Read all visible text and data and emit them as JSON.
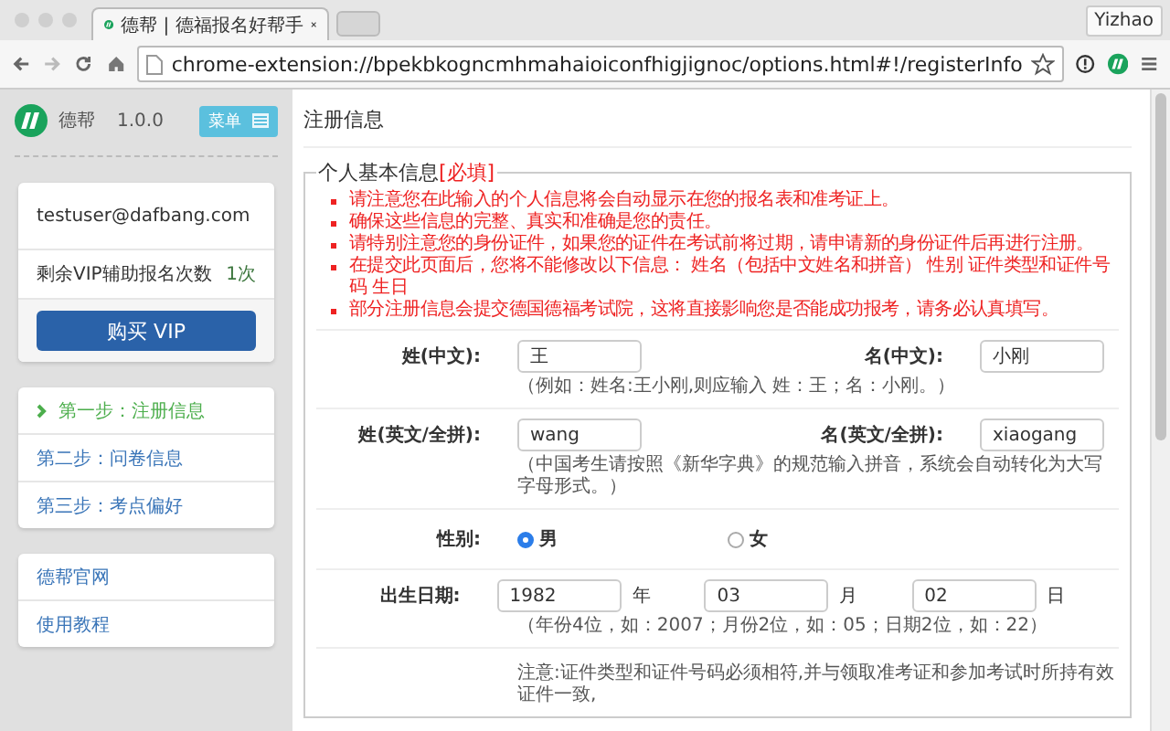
{
  "browser": {
    "tabs": [
      {
        "title": "德帮 | 德福报名好帮手",
        "selected": true
      }
    ],
    "profile": "Yizhao",
    "url": "chrome-extension://bpekbkogncmhmahaioiconfhigjignoc/options.html#!/registerInfo"
  },
  "sidebar": {
    "app_name": "德帮",
    "version": "1.0.0",
    "menu_button": "菜单",
    "account": {
      "email": "testuser@dafbang.com",
      "vip_label": "剩余VIP辅助报名次数",
      "vip_count": "1次",
      "buy_button": "购买 VIP"
    },
    "steps": [
      {
        "label": "第一步：注册信息",
        "selected": true
      },
      {
        "label": "第二步：问卷信息",
        "selected": false
      },
      {
        "label": "第三步：考点偏好",
        "selected": false
      }
    ],
    "links": [
      "德帮官网",
      "使用教程"
    ]
  },
  "content": {
    "title": "注册信息",
    "section": {
      "legend": "个人基本信息",
      "required_tag": "[必填]",
      "notices": [
        "请注意您在此输入的个人信息将会自动显示在您的报名表和准考证上。",
        "确保这些信息的完整、真实和准确是您的责任。",
        "请特别注意您的身份证件，如果您的证件在考试前将过期，请申请新的身份证件后再进行注册。",
        "在提交此页面后，您将不能修改以下信息： 姓名（包括中文姓名和拼音） 性别 证件类型和证件号码 生日",
        "部分注册信息会提交德国德福考试院，这将直接影响您是否能成功报考，请务必认真填写。"
      ],
      "rows": [
        {
          "kind": "pair",
          "fields": [
            {
              "label": "姓(中文):",
              "value": "王"
            },
            {
              "label": "名(中文):",
              "value": "小刚"
            }
          ],
          "hint": "（例如：姓名:王小刚,则应输入 姓：王；名：小刚。）"
        },
        {
          "kind": "pair",
          "fields": [
            {
              "label": "姓(英文/全拼):",
              "value": "wang"
            },
            {
              "label": "名(英文/全拼):",
              "value": "xiaogang"
            }
          ],
          "hint": "（中国考生请按照《新华字典》的规范输入拼音，系统会自动转化为大写字母形式。）"
        },
        {
          "kind": "radio",
          "label": "性别:",
          "options": [
            {
              "label": "男",
              "selected": true
            },
            {
              "label": "女",
              "selected": false
            }
          ]
        },
        {
          "kind": "date",
          "label": "出生日期:",
          "parts": [
            {
              "value": "1982",
              "unit": "年"
            },
            {
              "value": "03",
              "unit": "月"
            },
            {
              "value": "02",
              "unit": "日"
            }
          ],
          "hint": "（年份4位，如：2007；月份2位，如：05；日期2位，如：22）"
        },
        {
          "kind": "note",
          "text": "注意:证件类型和证件号码必须相符,并与领取准考证和参加考试时所持有效证件一致,"
        }
      ]
    }
  }
}
